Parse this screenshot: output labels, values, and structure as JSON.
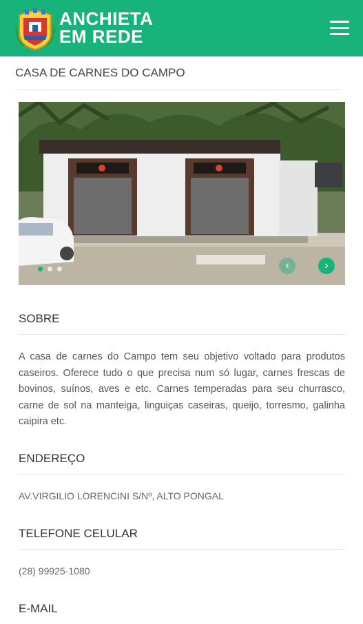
{
  "header": {
    "logo_line1": "ANCHIETA",
    "logo_line2": "EM REDE",
    "menu_icon": "hamburger-icon",
    "brand_color": "#18b27b"
  },
  "page": {
    "title": "CASA DE CARNES DO CAMPO"
  },
  "carousel": {
    "slide_count": 3,
    "active_index": 0,
    "prev_icon": "chevron-left-icon",
    "next_icon": "chevron-right-icon",
    "prev_glyph": "‹",
    "next_glyph": "›"
  },
  "sections": {
    "about_heading": "SOBRE",
    "about_text": "A casa de carnes do Campo tem seu objetivo voltado para produtos caseiros. Oferece tudo o que precisa num só lugar, carnes frescas de bovinos, suínos, aves e etc. Carnes temperadas para seu churrasco, carne de sol na manteiga, linguiças caseiras, queijo, torresmo, galinha caipira etc.",
    "address_heading": "ENDEREÇO",
    "address_value": "AV.VIRGILIO LORENCINI S/Nº, ALTO PONGAL",
    "phone_heading": "TELEFONE CELULAR",
    "phone_value": "(28) 99925-1080",
    "email_heading": "E-MAIL"
  }
}
